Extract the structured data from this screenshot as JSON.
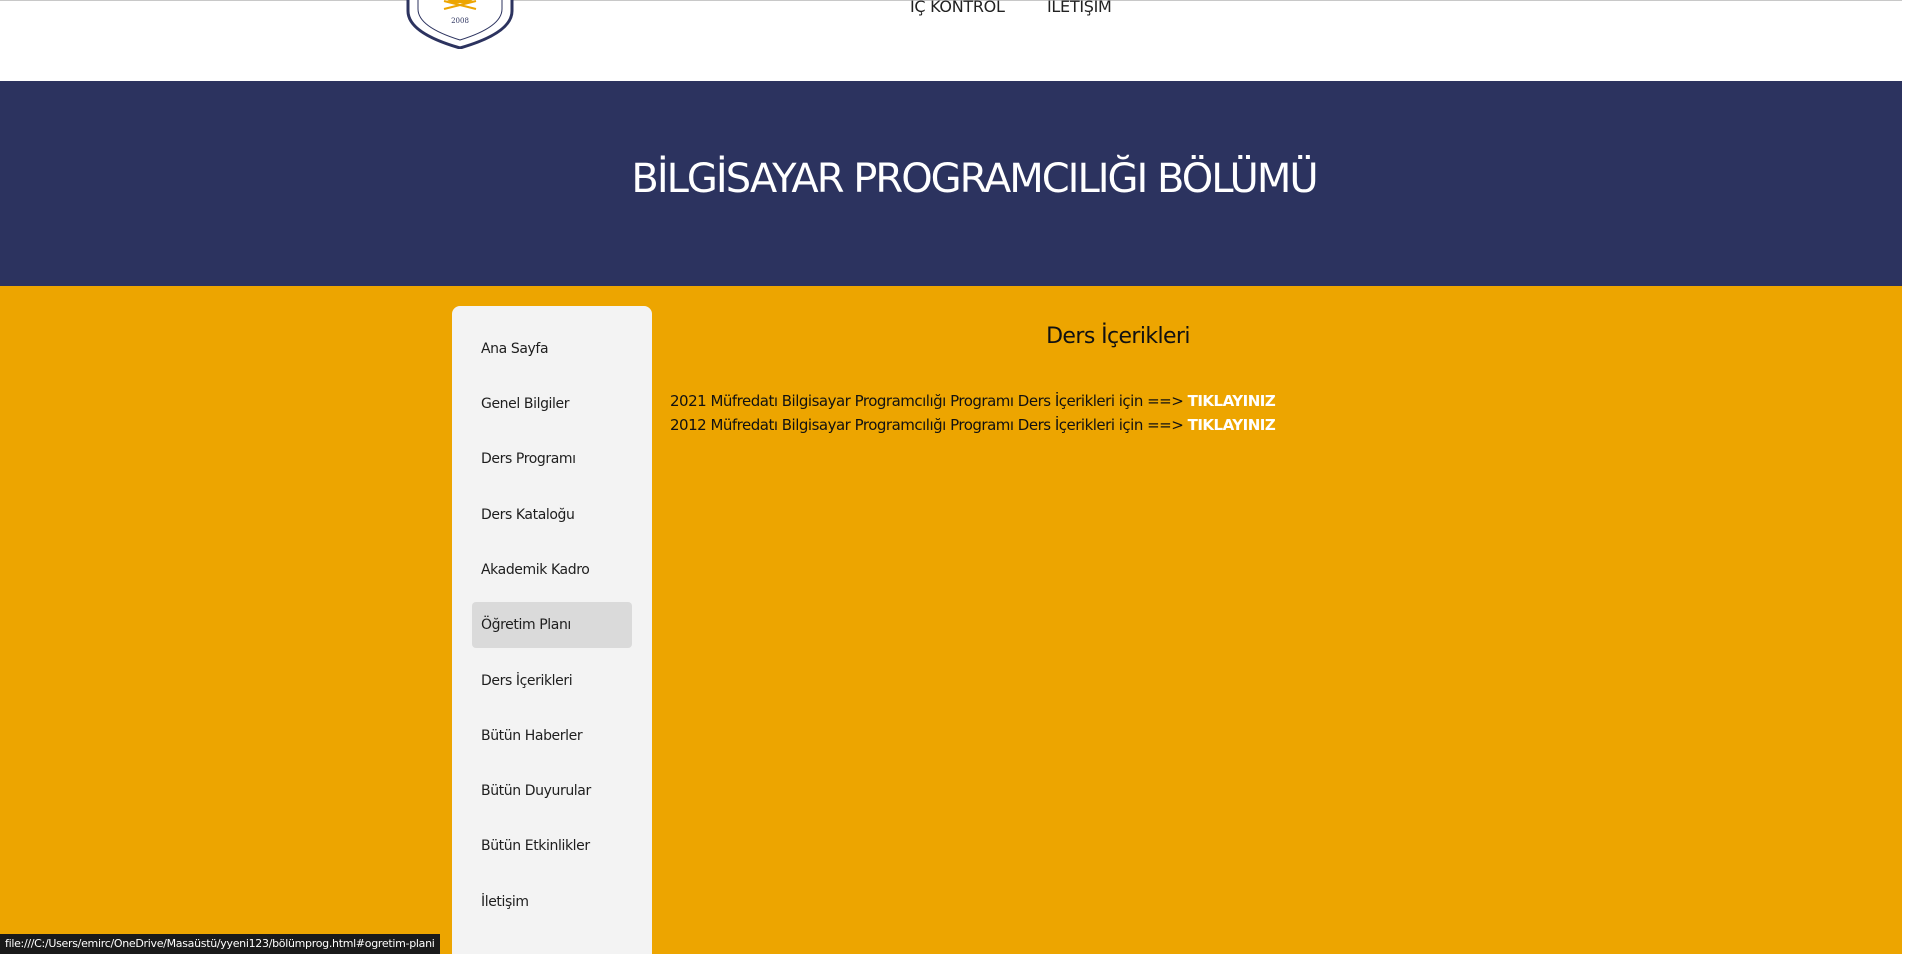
{
  "header": {
    "logo_year": "2008",
    "nav": [
      {
        "label": "İÇ KONTROL"
      },
      {
        "label": "İLETİŞİM"
      }
    ]
  },
  "banner": {
    "title": "BİLGİSAYAR PROGRAMCILIĞI BÖLÜMÜ"
  },
  "sidebar": {
    "items": [
      {
        "label": "Ana Sayfa"
      },
      {
        "label": "Genel Bilgiler"
      },
      {
        "label": "Ders Programı"
      },
      {
        "label": "Ders Kataloğu"
      },
      {
        "label": "Akademik Kadro"
      },
      {
        "label": "Öğretim Planı"
      },
      {
        "label": "Ders İçerikleri"
      },
      {
        "label": "Bütün Haberler"
      },
      {
        "label": "Bütün Duyurular"
      },
      {
        "label": "Bütün Etkinlikler"
      },
      {
        "label": "İletişim"
      }
    ],
    "active_label": "Öğretim Planı"
  },
  "main": {
    "title": "Ders İçerikleri",
    "lines": [
      {
        "text": "2021 Müfredatı Bilgisayar Programcılığı Programı Ders İçerikleri için ==> ",
        "link": "TIKLAYINIZ"
      },
      {
        "text": "2012 Müfredatı Bilgisayar Programcılığı Programı Ders İçerikleri için ==> ",
        "link": "TIKLAYINIZ"
      }
    ]
  },
  "status_bar": {
    "url": "file:///C:/Users/emirc/OneDrive/Masaüstü/yyeni123/bölümprog.html#ogretim-plani"
  },
  "colors": {
    "banner": "#2c335f",
    "accent": "#eda500",
    "sidebar_bg": "#f3f3f3",
    "sidebar_active": "#dadada",
    "link": "#ffffff"
  }
}
